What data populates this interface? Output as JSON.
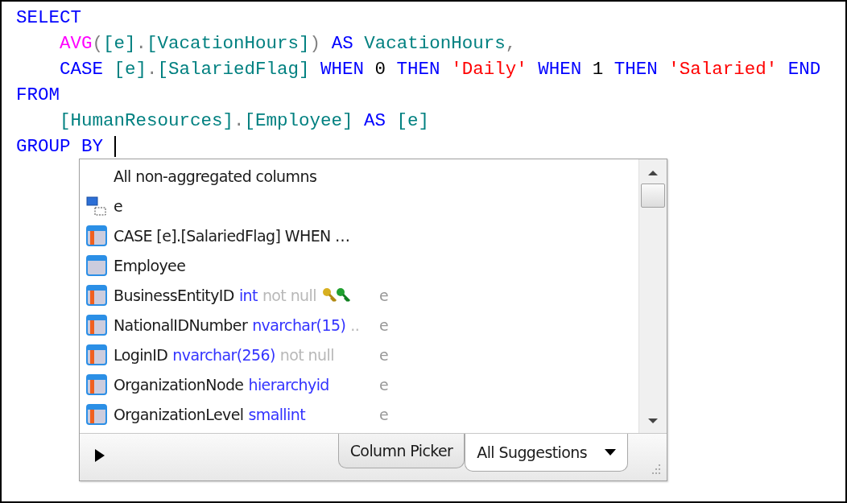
{
  "editor": {
    "lines": [
      [
        {
          "text": "SELECT",
          "kind": "keyword"
        }
      ],
      [
        {
          "text": "AVG",
          "kind": "function"
        },
        {
          "text": "(",
          "kind": "operator"
        },
        {
          "text": "[e]",
          "kind": "identifier"
        },
        {
          "text": ".",
          "kind": "operator"
        },
        {
          "text": "[VacationHours]",
          "kind": "identifier"
        },
        {
          "text": ")",
          "kind": "operator"
        },
        {
          "text": " AS ",
          "kind": "keyword"
        },
        {
          "text": "VacationHours",
          "kind": "identifier"
        },
        {
          "text": ",",
          "kind": "operator"
        }
      ],
      [
        {
          "text": "CASE ",
          "kind": "keyword"
        },
        {
          "text": "[e]",
          "kind": "identifier"
        },
        {
          "text": ".",
          "kind": "operator"
        },
        {
          "text": "[SalariedFlag]",
          "kind": "identifier"
        },
        {
          "text": " WHEN ",
          "kind": "keyword"
        },
        {
          "text": "0",
          "kind": "number"
        },
        {
          "text": " THEN ",
          "kind": "keyword"
        },
        {
          "text": "'Daily'",
          "kind": "string"
        },
        {
          "text": " WHEN ",
          "kind": "keyword"
        },
        {
          "text": "1",
          "kind": "number"
        },
        {
          "text": " THEN ",
          "kind": "keyword"
        },
        {
          "text": "'Salaried'",
          "kind": "string"
        },
        {
          "text": " END",
          "kind": "keyword"
        }
      ],
      [
        {
          "text": "FROM",
          "kind": "keyword"
        }
      ],
      [
        {
          "text": "[HumanResources]",
          "kind": "identifier"
        },
        {
          "text": ".",
          "kind": "operator"
        },
        {
          "text": "[Employee]",
          "kind": "identifier"
        },
        {
          "text": " AS ",
          "kind": "keyword"
        },
        {
          "text": "[e]",
          "kind": "identifier"
        }
      ],
      [
        {
          "text": "GROUP BY ",
          "kind": "keyword"
        }
      ]
    ],
    "indented": [
      false,
      true,
      true,
      false,
      true,
      false
    ]
  },
  "suggestions": {
    "items": [
      {
        "kind": "all",
        "name": "All non-aggregated columns"
      },
      {
        "kind": "alias",
        "name": "e"
      },
      {
        "kind": "column",
        "name": "CASE [e].[SalariedFlag] WHEN …"
      },
      {
        "kind": "table",
        "name": "Employee"
      },
      {
        "kind": "column",
        "name": "BusinessEntityID",
        "type": "int",
        "extra": "not null",
        "keys": true,
        "source": "e"
      },
      {
        "kind": "column",
        "name": "NationalIDNumber",
        "type": "nvarchar(15)",
        "extra": "..",
        "source": "e"
      },
      {
        "kind": "column",
        "name": "LoginID",
        "type": "nvarchar(256)",
        "extra": "not null",
        "source": "e"
      },
      {
        "kind": "column",
        "name": "OrganizationNode",
        "type": "hierarchyid",
        "source": "e"
      },
      {
        "kind": "column",
        "name": "OrganizationLevel",
        "type": "smallint",
        "source": "e"
      }
    ],
    "tabs": [
      {
        "label": "Column Picker",
        "selected": false,
        "dropdown": false
      },
      {
        "label": "All Suggestions",
        "selected": true,
        "dropdown": true
      }
    ]
  }
}
